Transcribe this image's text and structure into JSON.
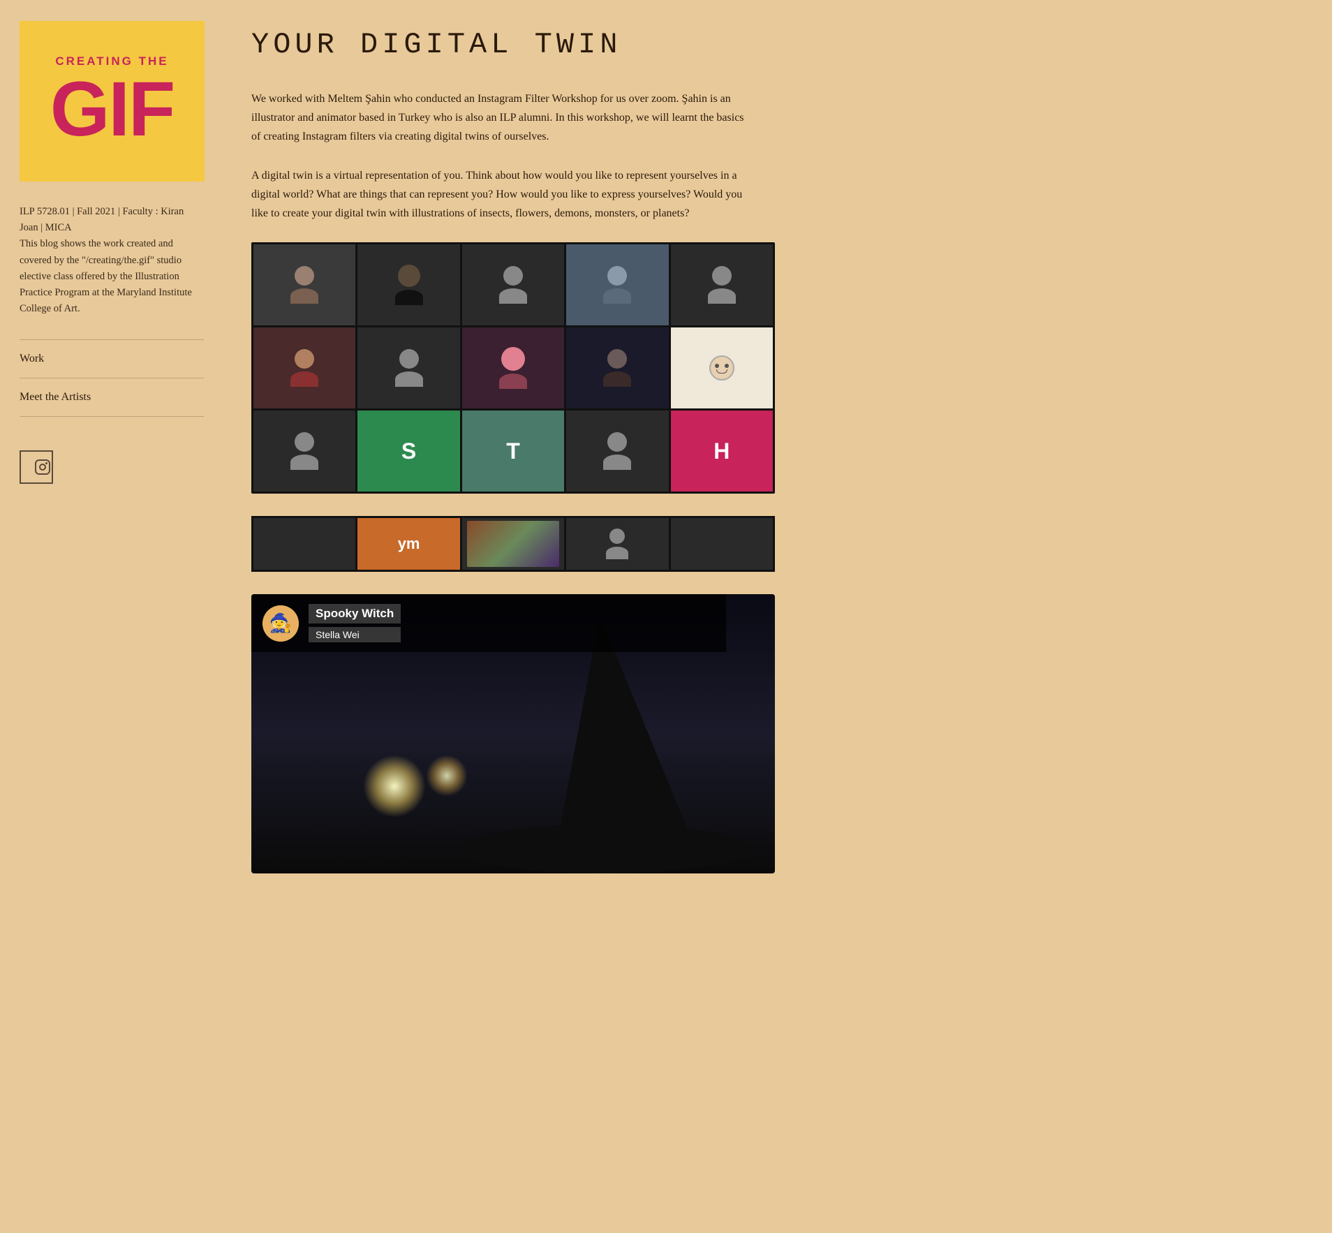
{
  "sidebar": {
    "logo": {
      "top_text": "CREATING THE",
      "main_text": "GIF"
    },
    "description": "ILP 5728.01 | Fall 2021 | Faculty : Kiran Joan | MICA\nThis blog shows the work created and covered by the \"/creating/the.gif\" studio elective class offered by the Illustration Practice Program at the Maryland Institute College of Art.",
    "nav_items": [
      {
        "label": "Work",
        "id": "work"
      },
      {
        "label": "Meet the Artists",
        "id": "meet-the-artists"
      }
    ],
    "instagram_label": "Instagram"
  },
  "main": {
    "page_title": "YOUR DIGITAL TWIN",
    "intro_paragraph_1": "We worked with Meltem Şahin who conducted an Instagram Filter Workshop for us over zoom. Şahin is an illustrator and animator based in Turkey who is also an ILP alumni. In this workshop, we will learnt the basics of creating Instagram filters via creating digital twins of ourselves.",
    "intro_paragraph_2": "A digital twin is a virtual representation of you. Think about how would you like to represent yourselves in a digital world?  What are things that can represent you? How would you like to express yourselves? Would you like to create your digital twin with illustrations of insects, flowers, demons, monsters, or planets?",
    "instagram_post": {
      "title": "Spooky Witch",
      "subtitle": "Stella Wei",
      "actions": [
        "♡",
        "⊙",
        "◁",
        "▼"
      ]
    },
    "zoom_grid": {
      "cells": [
        {
          "type": "person",
          "row": 1,
          "col": 1
        },
        {
          "type": "person",
          "row": 1,
          "col": 2
        },
        {
          "type": "placeholder",
          "row": 1,
          "col": 3
        },
        {
          "type": "person",
          "row": 1,
          "col": 4
        },
        {
          "type": "placeholder",
          "row": 1,
          "col": 5
        },
        {
          "type": "person",
          "row": 2,
          "col": 1
        },
        {
          "type": "placeholder",
          "row": 2,
          "col": 2
        },
        {
          "type": "person_pink",
          "row": 2,
          "col": 3
        },
        {
          "type": "person_dark",
          "row": 2,
          "col": 4
        },
        {
          "type": "drawing",
          "row": 2,
          "col": 5
        },
        {
          "type": "placeholder",
          "row": 3,
          "col": 1
        },
        {
          "type": "letter",
          "letter": "S",
          "bg": "green",
          "row": 3,
          "col": 2
        },
        {
          "type": "letter",
          "letter": "T",
          "bg": "teal",
          "row": 3,
          "col": 3
        },
        {
          "type": "placeholder",
          "row": 3,
          "col": 4
        },
        {
          "type": "letter",
          "letter": "H",
          "bg": "pink",
          "row": 3,
          "col": 5
        }
      ]
    }
  },
  "colors": {
    "background": "#e8c99a",
    "accent_red": "#c8235a",
    "logo_yellow": "#f5c842",
    "text_dark": "#2a1a0a",
    "nav_border": "#c4a07a"
  }
}
